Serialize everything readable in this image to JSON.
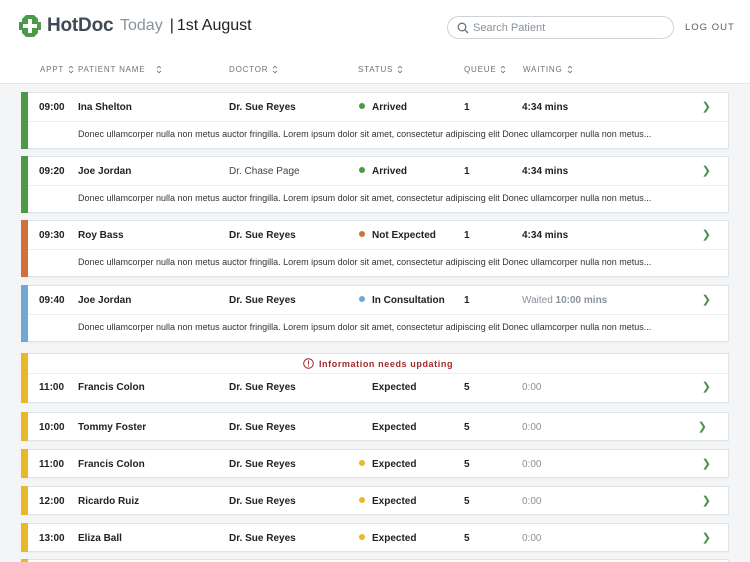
{
  "app": {
    "name": "HotDoc",
    "brand_color": "#4a9a4a"
  },
  "header": {
    "today_label": "Today",
    "separator": "|",
    "date": "1st August"
  },
  "search": {
    "placeholder": "Search Patient",
    "value": ""
  },
  "logout_label": "LOG OUT",
  "columns": {
    "appt": "APPT",
    "patient": "PATIENT NAME",
    "doctor": "DOCTOR",
    "status": "STATUS",
    "queue": "QUEUE",
    "waiting": "WAITING"
  },
  "colors": {
    "arrived": "#4a9a4a",
    "not_expected": "#d0703a",
    "in_consultation": "#6fa8d4",
    "expected": "#e8b828",
    "alert": "#a02a2a"
  },
  "appointments": [
    {
      "time": "09:00",
      "patient": "Ina Shelton",
      "doctor": "Dr. Sue Reyes",
      "status": "Arrived",
      "status_color": "#4a9a4a",
      "queue": "1",
      "waiting": "4:34 mins",
      "note": "Donec ullamcorper nulla non metus auctor fringilla. Lorem ipsum dolor sit amet, consectetur adipiscing elit Donec ullamcorper nulla non metus..."
    },
    {
      "time": "09:20",
      "patient": "Joe Jordan",
      "doctor": "Dr. Chase Page",
      "status": "Arrived",
      "status_color": "#4a9a4a",
      "queue": "1",
      "waiting": "4:34 mins",
      "note": "Donec ullamcorper nulla non metus auctor fringilla. Lorem ipsum dolor sit amet, consectetur adipiscing elit Donec ullamcorper nulla non metus..."
    },
    {
      "time": "09:30",
      "patient": "Roy Bass",
      "doctor": "Dr. Sue Reyes",
      "status": "Not Expected",
      "status_color": "#d0703a",
      "queue": "1",
      "waiting": "4:34 mins",
      "note": "Donec ullamcorper nulla non metus auctor fringilla. Lorem ipsum dolor sit amet, consectetur adipiscing elit Donec ullamcorper nulla non metus..."
    },
    {
      "time": "09:40",
      "patient": "Joe Jordan",
      "doctor": "Dr. Sue Reyes",
      "status": "In Consultation",
      "status_color": "#6fa8d4",
      "queue": "1",
      "waiting_prefix": "Waited",
      "waiting": "10:00 mins",
      "note": "Donec ullamcorper nulla non metus auctor fringilla. Lorem ipsum dolor sit amet, consectetur adipiscing elit Donec ullamcorper nulla non metus..."
    },
    {
      "alert": "Information needs updating",
      "time": "11:00",
      "patient": "Francis Colon",
      "doctor": "Dr. Sue Reyes",
      "status": "Expected",
      "queue": "5",
      "waiting": "0:00"
    },
    {
      "time": "10:00",
      "patient": "Tommy Foster",
      "doctor": "Dr. Sue Reyes",
      "status": "Expected",
      "queue": "5",
      "waiting": "0:00"
    },
    {
      "time": "11:00",
      "patient": "Francis Colon",
      "doctor": "Dr. Sue Reyes",
      "status": "Expected",
      "status_color": "#e8b828",
      "queue": "5",
      "waiting": "0:00"
    },
    {
      "time": "12:00",
      "patient": "Ricardo Ruiz",
      "doctor": "Dr. Sue Reyes",
      "status": "Expected",
      "status_color": "#e8b828",
      "queue": "5",
      "waiting": "0:00"
    },
    {
      "time": "13:00",
      "patient": "Eliza Ball",
      "doctor": "Dr. Sue Reyes",
      "status": "Expected",
      "status_color": "#e8b828",
      "queue": "5",
      "waiting": "0:00"
    }
  ]
}
